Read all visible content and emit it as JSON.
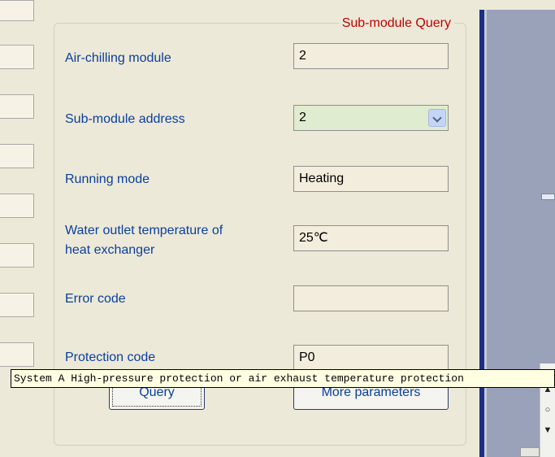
{
  "group": {
    "title": "Sub-module Query"
  },
  "fields": {
    "air_chilling_module": {
      "label": "Air-chilling module",
      "value": "2"
    },
    "sub_module_address": {
      "label": "Sub-module address",
      "value": "2"
    },
    "running_mode": {
      "label": "Running mode",
      "value": "Heating"
    },
    "water_outlet_temp": {
      "label_line1": "Water outlet temperature of",
      "label_line2": "heat exchanger",
      "value": "25℃"
    },
    "error_code": {
      "label": "Error code",
      "value": ""
    },
    "protection_code": {
      "label": "Protection code",
      "value": "P0"
    }
  },
  "tooltip": {
    "text": "System A High-pressure protection or air exhaust temperature protection"
  },
  "buttons": {
    "query": "Query",
    "more_parameters": "More parameters"
  },
  "scrollbar": {
    "up": "▲",
    "thumb": "○",
    "down": "▼"
  },
  "icons": {
    "dropdown": "chevron-down-icon"
  }
}
